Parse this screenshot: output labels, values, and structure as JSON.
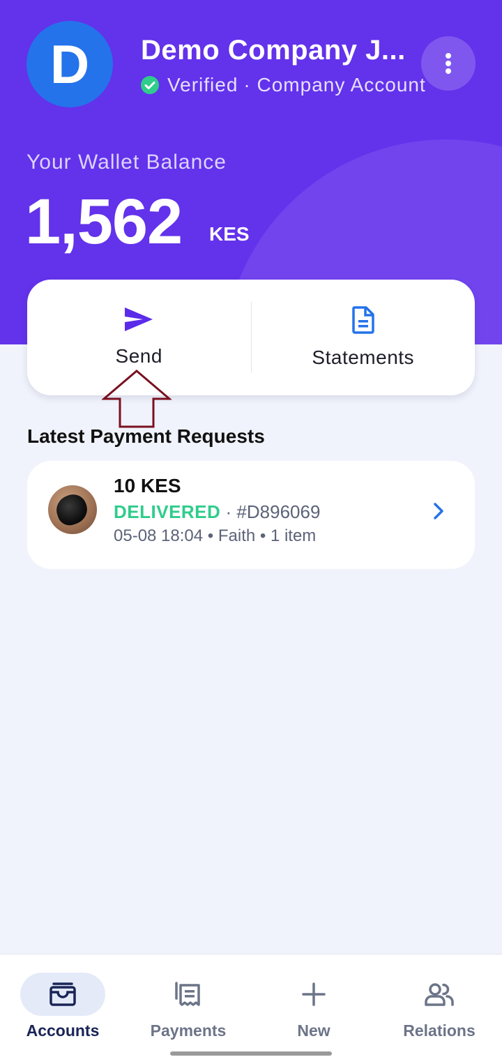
{
  "colors": {
    "header": "#6332eb",
    "accent": "#5b2bea",
    "avatar": "#2473ea",
    "verified": "#2fcc8b",
    "delivered": "#2fcc8b",
    "link": "#2473ea"
  },
  "header": {
    "avatar_letter": "D",
    "company_name": "Demo Company J...",
    "verified_label": "Verified",
    "account_type": "· Company Account",
    "more_icon": "more-vertical-icon"
  },
  "wallet": {
    "label": "Your Wallet Balance",
    "amount": "1,562",
    "currency": "KES"
  },
  "actions": [
    {
      "label": "Send",
      "icon": "send-icon"
    },
    {
      "label": "Statements",
      "icon": "document-icon"
    }
  ],
  "latest_requests": {
    "title": "Latest Payment Requests",
    "items": [
      {
        "amount": "10 KES",
        "status": "DELIVERED",
        "id_text": " · #D896069",
        "meta": "05-08 18:04 • Faith • 1 item"
      }
    ]
  },
  "bottom_nav": [
    {
      "label": "Accounts",
      "icon": "wallet-icon",
      "active": true
    },
    {
      "label": "Payments",
      "icon": "receipt-icon",
      "active": false
    },
    {
      "label": "New",
      "icon": "plus-icon",
      "active": false
    },
    {
      "label": "Relations",
      "icon": "people-icon",
      "active": false
    }
  ]
}
